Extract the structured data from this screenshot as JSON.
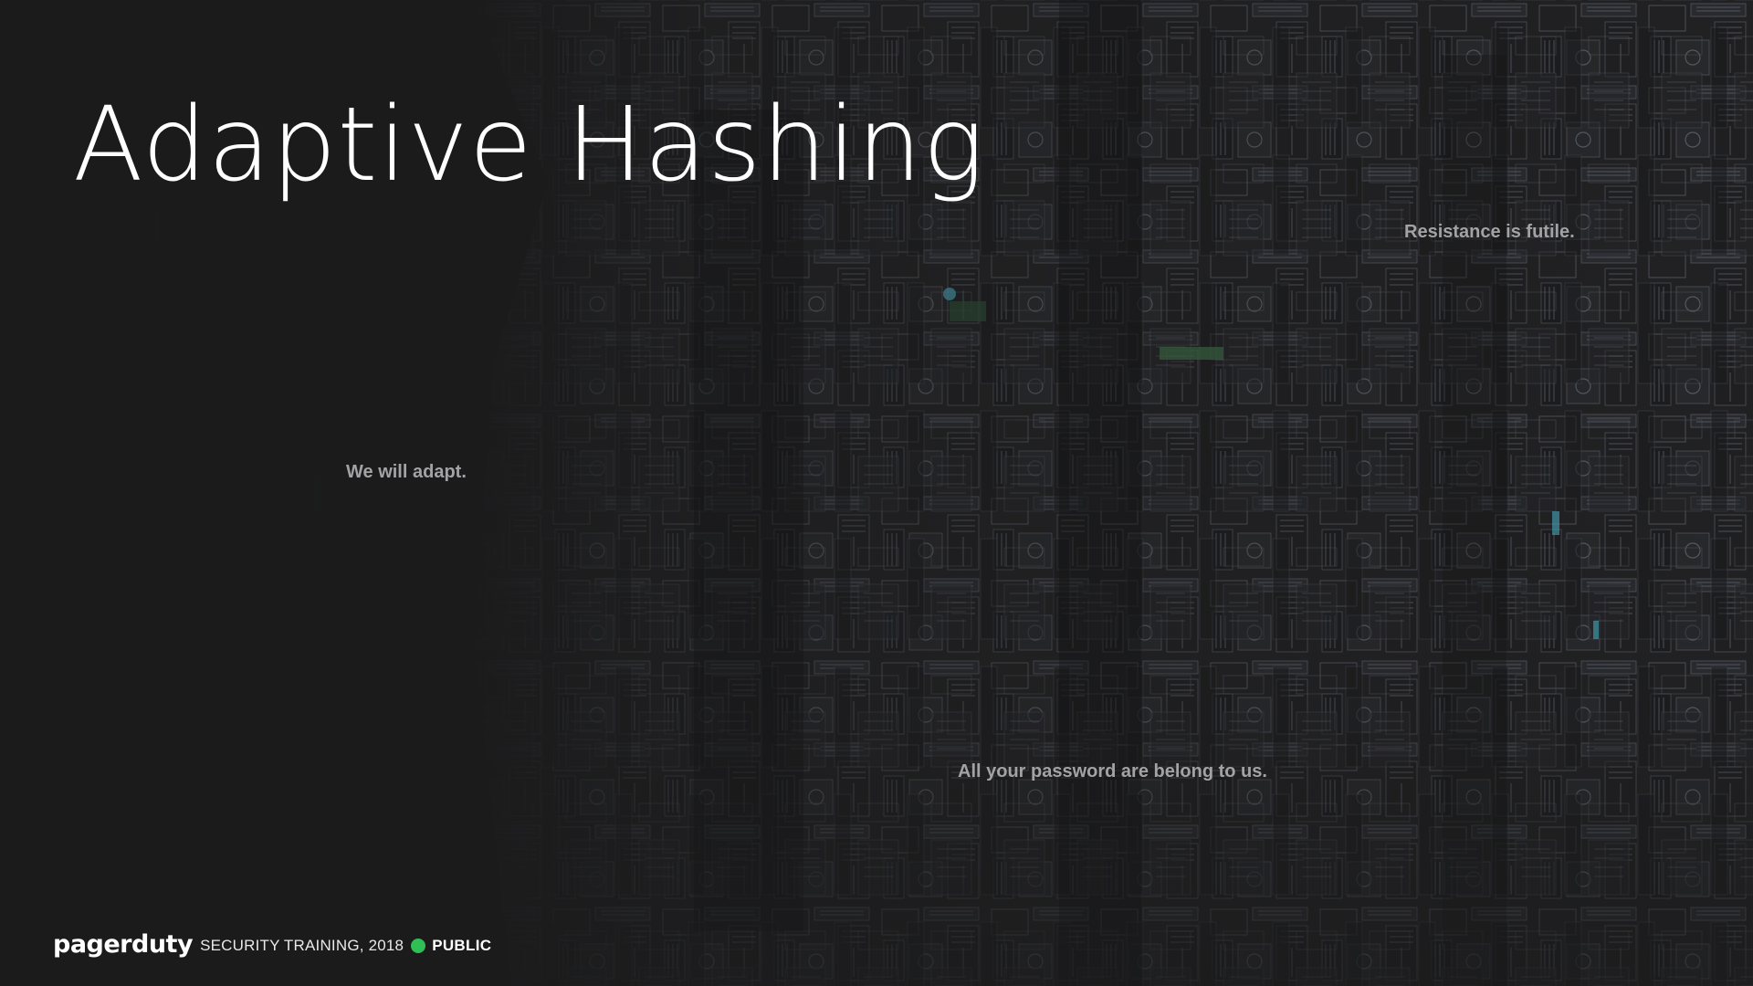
{
  "slide": {
    "title": "Adaptive Hashing",
    "captions": {
      "resistance": "Resistance is futile.",
      "adapt": "We will adapt.",
      "belong": "All your password are belong to us."
    }
  },
  "footer": {
    "brand": "pagerduty",
    "event_text": "SECURITY TRAINING, 2018",
    "classification": "PUBLIC"
  },
  "colors": {
    "background": "#1b1b1c",
    "title": "#ffffff",
    "caption": "#a3a3a6",
    "status_dot": "#2fbf55"
  },
  "background_image": "borg-cube-machinery"
}
